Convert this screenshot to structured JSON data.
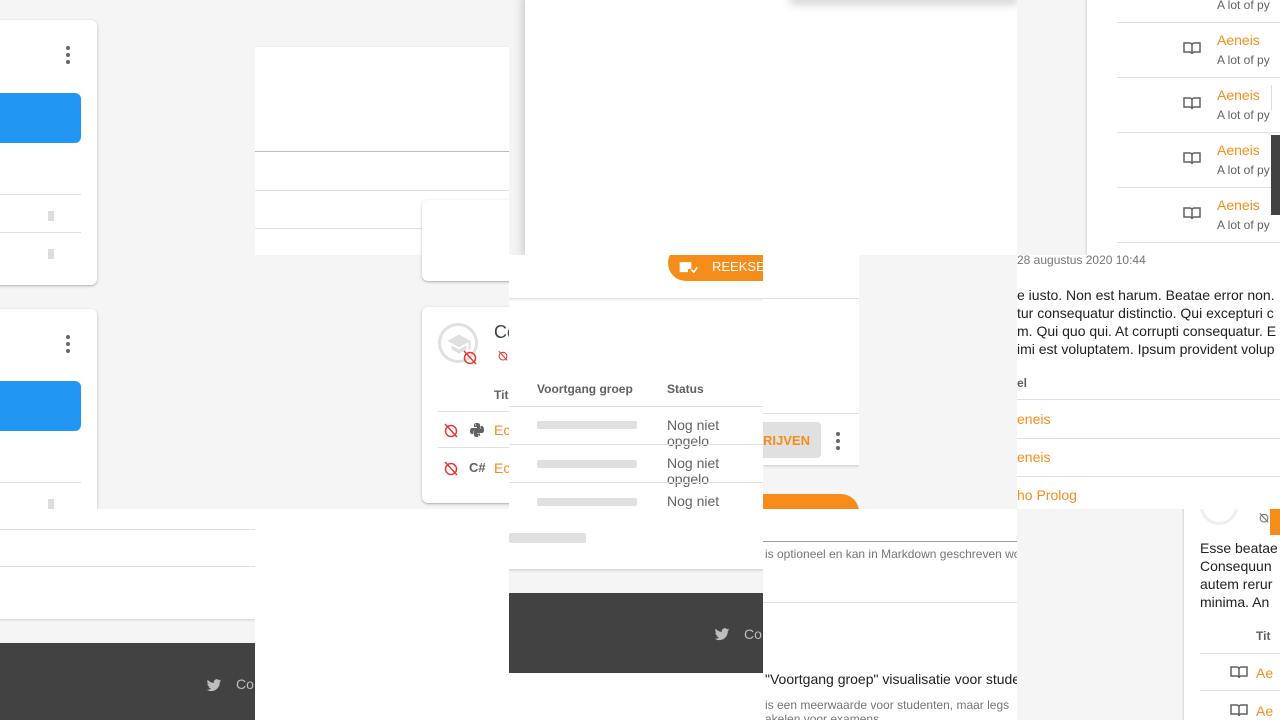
{
  "tiles": {
    "lang_cards": {
      "c_sharp_label": "C#",
      "exercise_prefix": "Ec"
    },
    "course_card": {
      "title_prefix": "Co",
      "col_title_prefix": "Tit"
    },
    "series_panel": {
      "add_series_prefix": "REEKSE",
      "columns": [
        "Voortgang groep",
        "Status"
      ],
      "rows": [
        "Nog niet opgelo",
        "Nog niet opgelo",
        "Nog niet opgelo"
      ],
      "subscribe_suffix": "RIJVEN"
    },
    "right_list": {
      "items": [
        {
          "title": "Aeneis",
          "subtitle": "A lot of py"
        },
        {
          "title": "Aeneis",
          "subtitle": "A lot of py"
        },
        {
          "title": "Aeneis",
          "subtitle": "A lot of py"
        },
        {
          "title": "Aeneis",
          "subtitle": "A lot of py"
        }
      ],
      "top_subtitle": "A lot of py"
    },
    "description": {
      "timestamp": "28 augustus 2020 10:44",
      "lines": [
        "e iusto. Non est harum. Beatae error non.",
        "tur consequatur distinctio. Qui excepturi c",
        "m. Qui quo qui. At corrupti consequatur. E",
        "imi est voluptatem. Ipsum provident volup"
      ],
      "col_header": "el",
      "links": [
        "eneis",
        "eneis",
        "ho Prolog"
      ]
    },
    "bottom_right": {
      "lines": [
        "Esse beatae",
        "Consequun",
        "autem rerur",
        "minima. An"
      ],
      "col_header": "Tit",
      "links": [
        "Ae",
        "Ae"
      ]
    },
    "form": {
      "markdown_hint": "is optioneel en kan in Markdown geschreven wo",
      "checkbox_label": "\"Voortgang groep\" visualisatie voor stude",
      "checkbox_help_1": "is een meerwaarde voor studenten, maar legs",
      "checkbox_help_2": "akelen voor examens."
    },
    "footer": {
      "label": "Co"
    }
  },
  "colors": {
    "accent": "#f68d1a",
    "primary": "#2196f3",
    "footer": "#424242",
    "danger": "#e53935"
  },
  "icons": [
    "more-vert-icon",
    "school-icon",
    "alarm-off-icon",
    "python-icon",
    "book-icon",
    "twitter-icon",
    "playlist-add-icon"
  ]
}
